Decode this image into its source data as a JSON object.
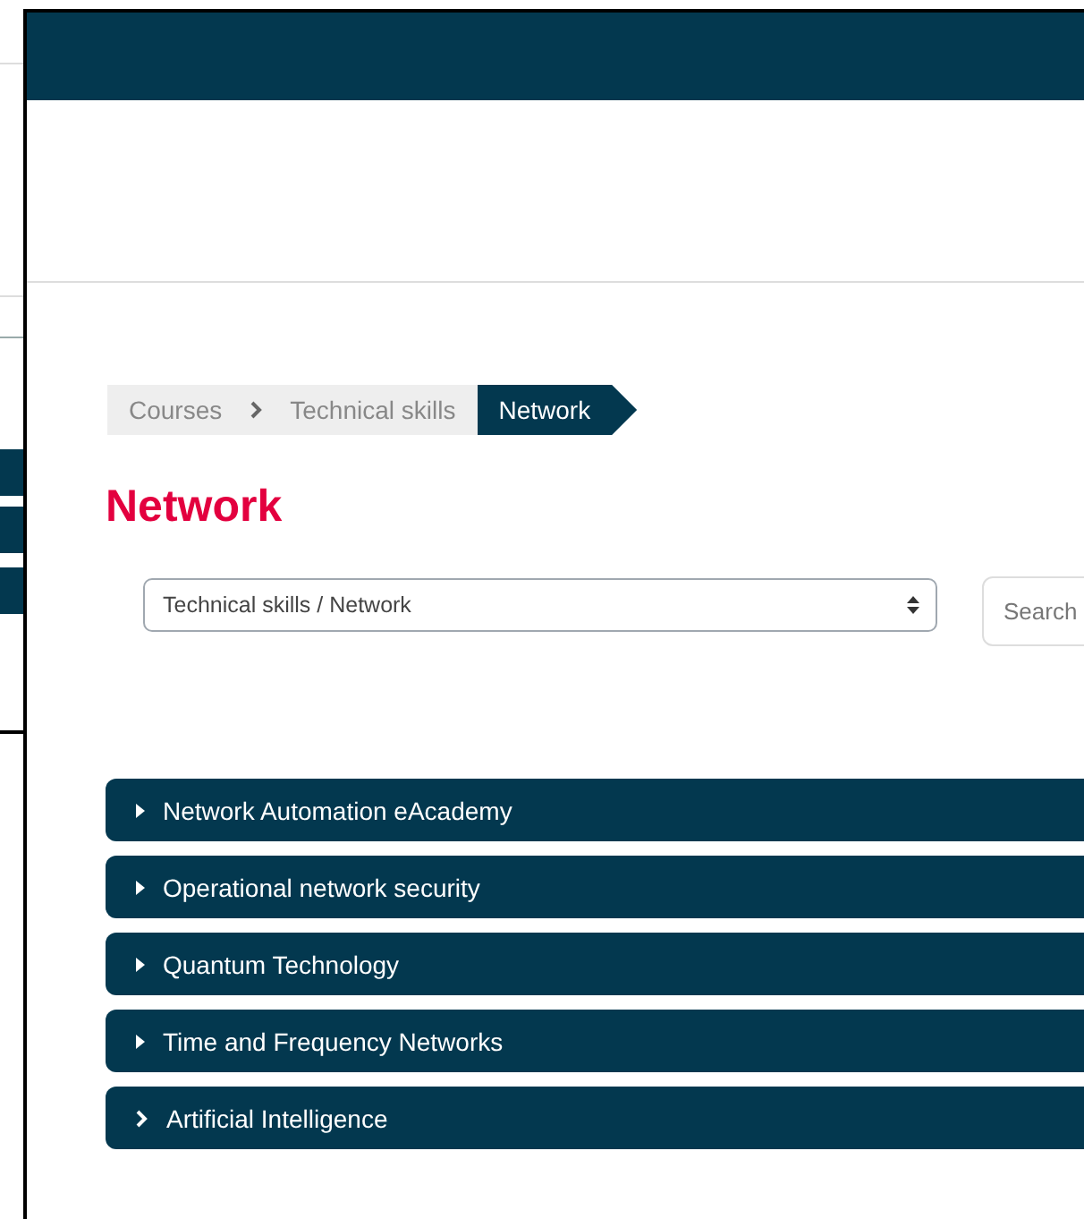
{
  "breadcrumb": [
    {
      "label": "Courses",
      "selected": false
    },
    {
      "label": "Technical skills",
      "selected": false
    },
    {
      "label": "Network",
      "selected": true
    }
  ],
  "heading": "Network",
  "category_select": {
    "value": "Technical skills / Network"
  },
  "search": {
    "placeholder": "Search"
  },
  "categories": [
    {
      "label": "Network Automation eAcademy",
      "kind": "collapsible"
    },
    {
      "label": "Operational network security",
      "kind": "collapsible"
    },
    {
      "label": "Quantum Technology",
      "kind": "collapsible"
    },
    {
      "label": "Time and Frequency Networks",
      "kind": "collapsible"
    },
    {
      "label": "Artificial Intelligence",
      "kind": "link"
    }
  ]
}
